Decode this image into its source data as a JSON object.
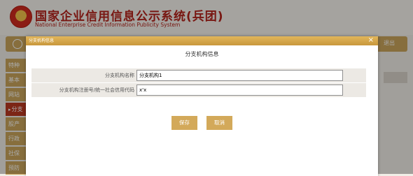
{
  "site": {
    "title": "国家企业信用信息公示系统(兵团)",
    "subtitle": "National Enterprise Credit Information Publicity System"
  },
  "nav": {
    "right_label": "退出"
  },
  "sidebar": {
    "items": [
      {
        "label": "特种"
      },
      {
        "label": "基本"
      },
      {
        "label": "网站"
      },
      {
        "label": "分支",
        "active": true
      },
      {
        "label": "股产"
      },
      {
        "label": "行政"
      },
      {
        "label": "社保"
      },
      {
        "label": "预防"
      }
    ]
  },
  "modal": {
    "title": "分支机构信息",
    "heading": "分支机构信息",
    "close": "×",
    "fields": [
      {
        "label": "分支机构名称",
        "value": "分支机构1"
      },
      {
        "label": "分支机构注册号/统一社会信用代码",
        "value": "x'x"
      }
    ],
    "save_label": "保存",
    "cancel_label": "取消"
  },
  "colors": {
    "brand_red": "#b4231b",
    "gold": "#caa55c",
    "button_gold": "#d3a95a"
  }
}
